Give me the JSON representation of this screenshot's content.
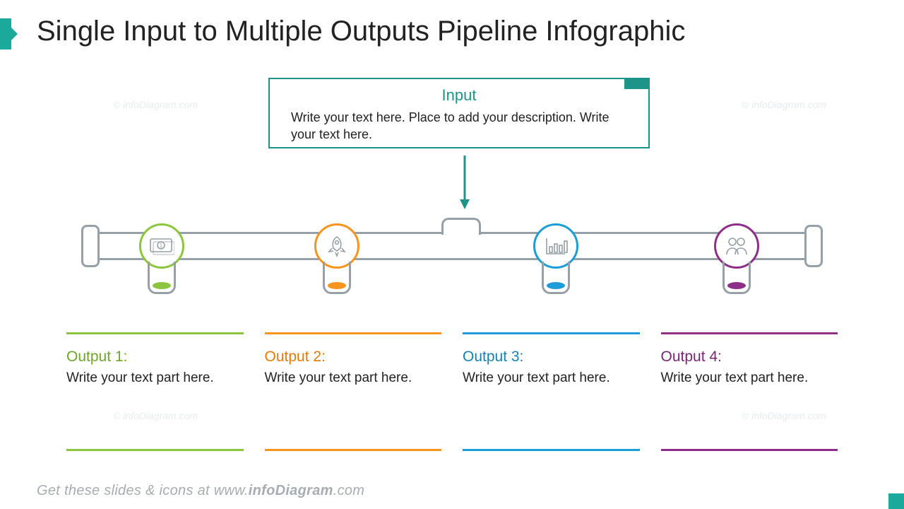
{
  "title": "Single Input to Multiple Outputs Pipeline Infographic",
  "input": {
    "title": "Input",
    "body": "Write your text here. Place to add your description. Write your text here."
  },
  "outputs": [
    {
      "title": "Output 1:",
      "body": "Write your text part here.",
      "color": "#8cc63e",
      "icon": "money-icon"
    },
    {
      "title": "Output 2:",
      "body": "Write your text part here.",
      "color": "#f7941d",
      "icon": "rocket-icon"
    },
    {
      "title": "Output 3:",
      "body": "Write your text part here.",
      "color": "#1e9cd7",
      "icon": "bar-chart-icon"
    },
    {
      "title": "Output 4:",
      "body": "Write your text part here.",
      "color": "#8e2e88",
      "icon": "people-icon"
    }
  ],
  "footer": {
    "prefix": "Get these slides & icons at www.",
    "brand": "infoDiagram",
    "suffix": ".com"
  },
  "watermark": "© infoDiagram.com"
}
